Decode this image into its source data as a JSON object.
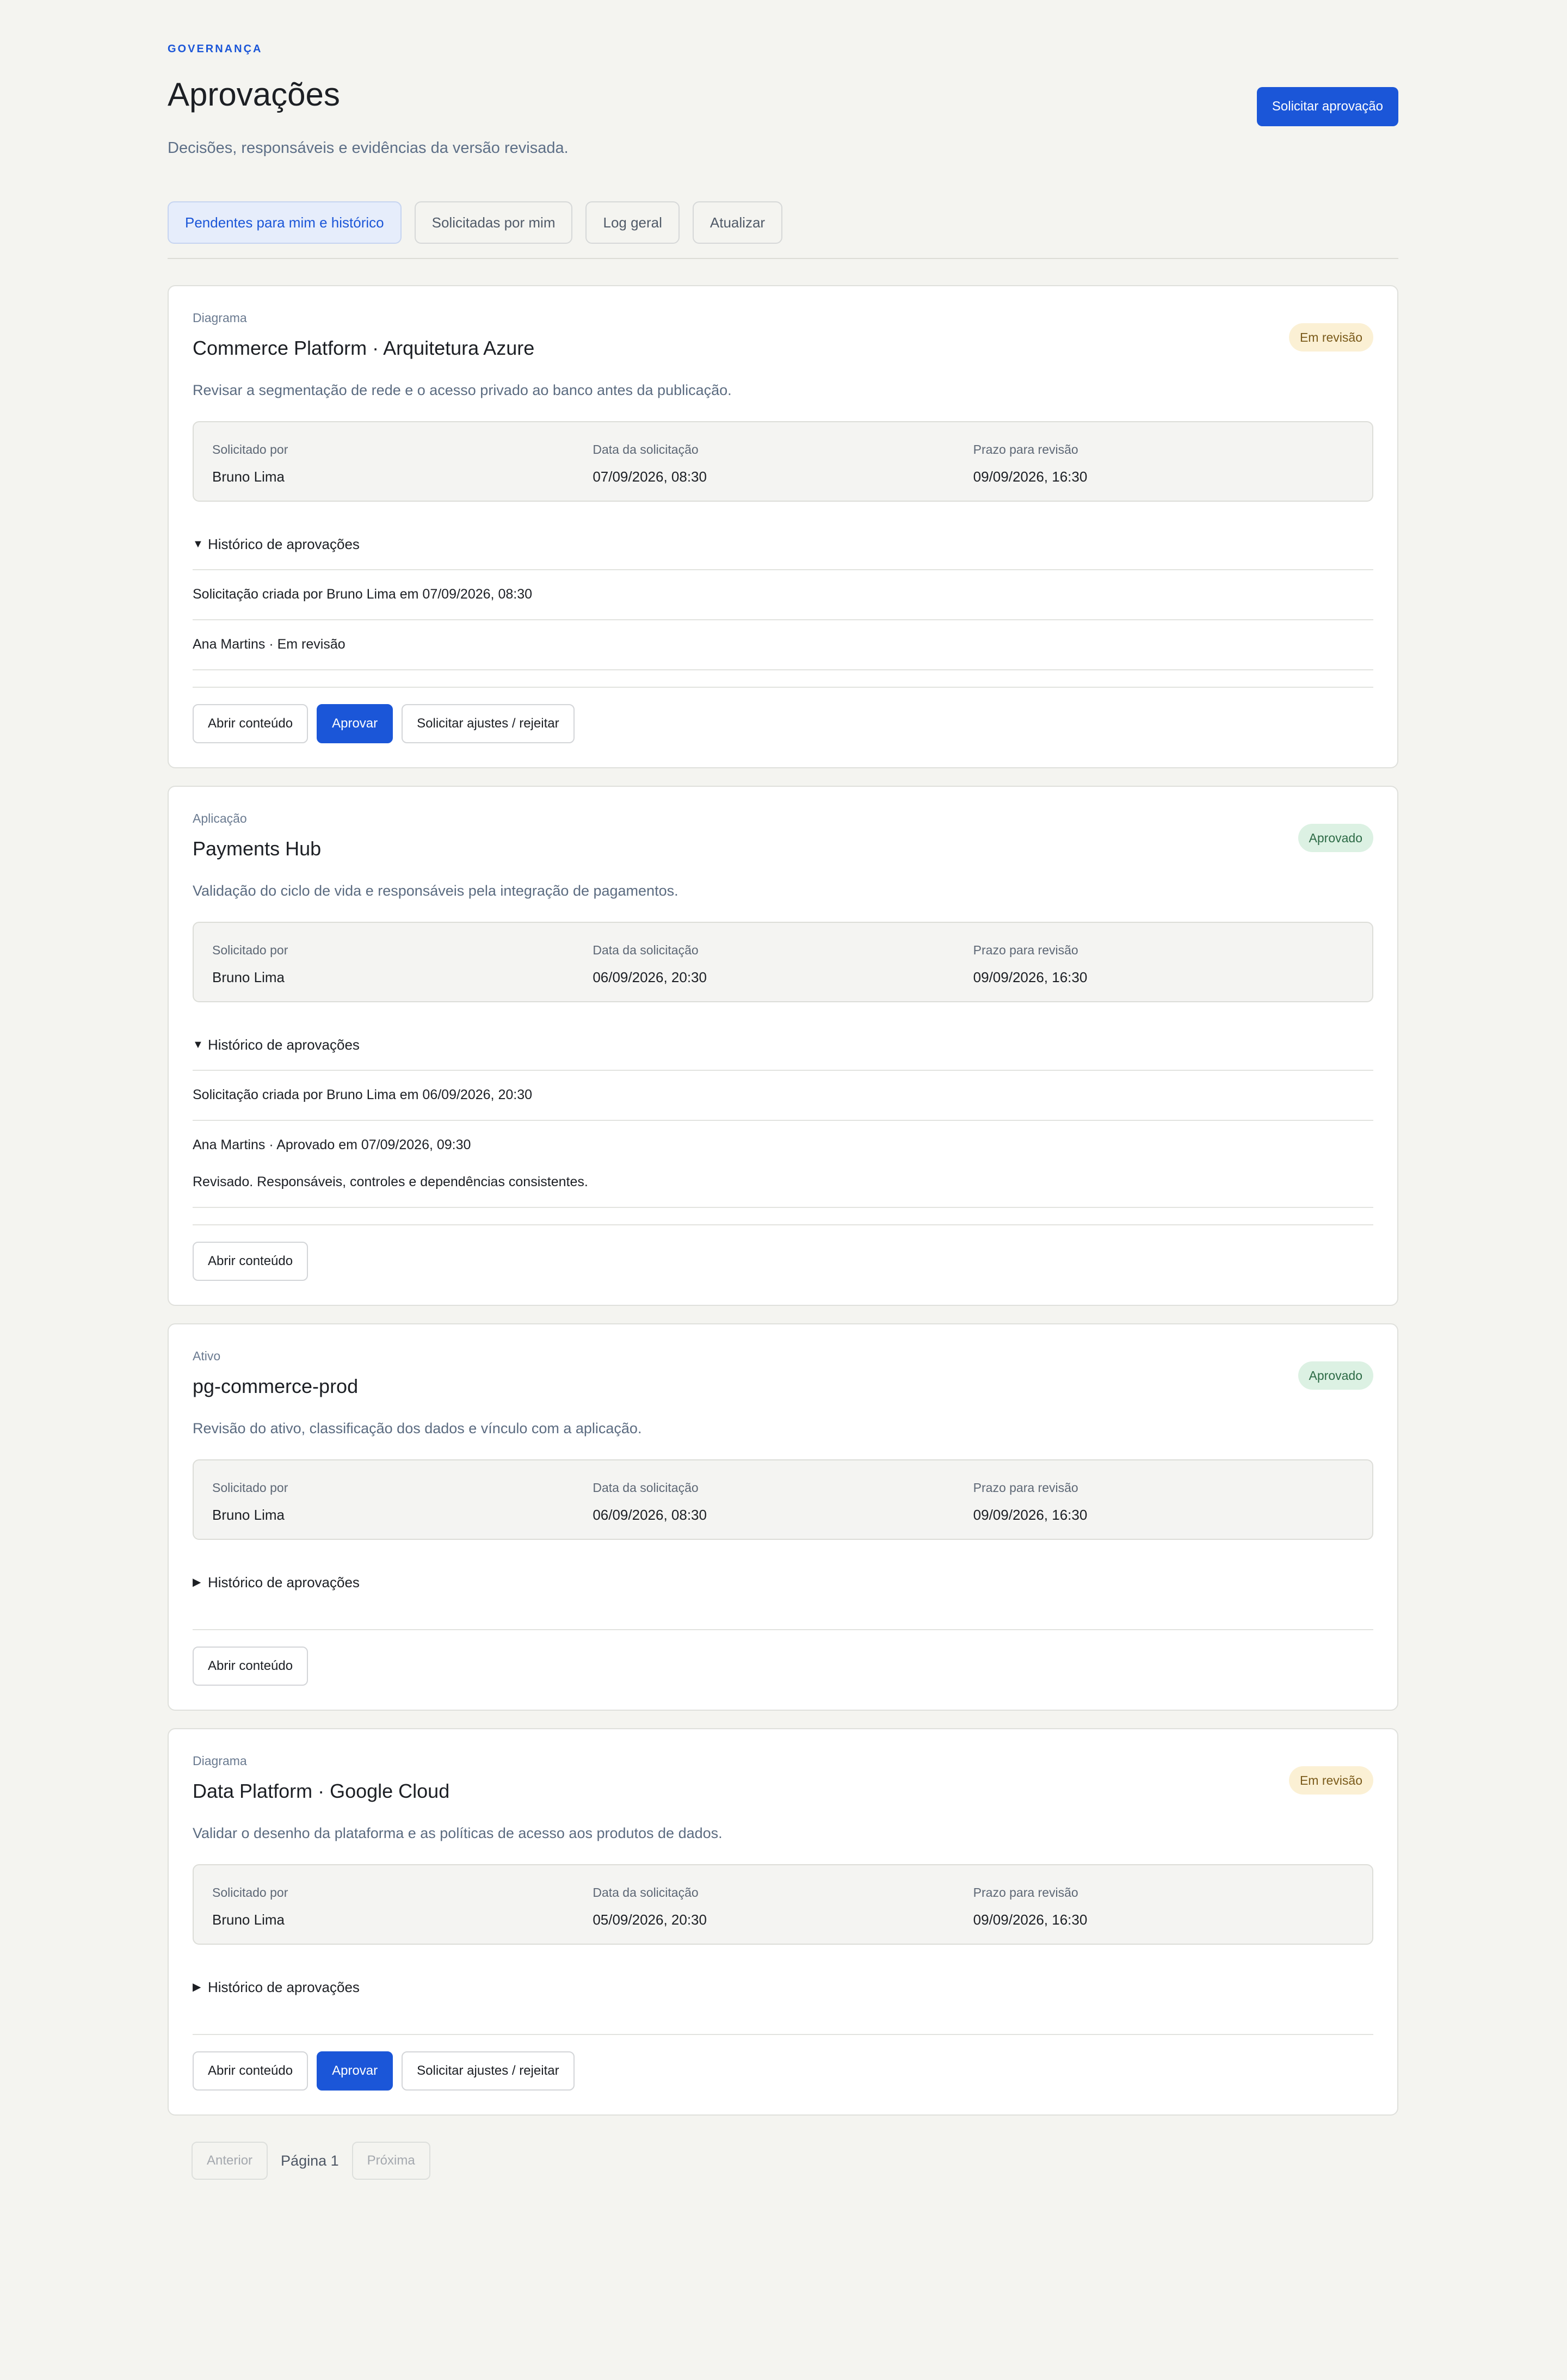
{
  "header": {
    "eyebrow": "GOVERNANÇA",
    "title": "Aprovações",
    "subtitle": "Decisões, responsáveis e evidências da versão revisada.",
    "request_button": "Solicitar aprovação"
  },
  "tabs": [
    {
      "label": "Pendentes para mim e histórico",
      "active": true
    },
    {
      "label": "Solicitadas por mim",
      "active": false
    },
    {
      "label": "Log geral",
      "active": false
    },
    {
      "label": "Atualizar",
      "active": false
    }
  ],
  "meta_labels": {
    "requested_by": "Solicitado por",
    "request_date": "Data da solicitação",
    "review_deadline": "Prazo para revisão"
  },
  "history_label": "Histórico de aprovações",
  "actions": {
    "open": "Abrir conteúdo",
    "approve": "Aprovar",
    "request_changes": "Solicitar ajustes / rejeitar"
  },
  "cards": [
    {
      "type": "Diagrama",
      "title": "Commerce Platform · Arquitetura Azure",
      "status": "Em revisão",
      "status_kind": "review",
      "description": "Revisar a segmentação de rede e o acesso privado ao banco antes da publicação.",
      "requested_by": "Bruno Lima",
      "request_date": "07/09/2026, 08:30",
      "review_deadline": "09/09/2026, 16:30",
      "history_open": true,
      "history": [
        {
          "text": "Solicitação criada por Bruno Lima em 07/09/2026, 08:30"
        },
        {
          "text": "Ana Martins · Em revisão"
        }
      ]
    },
    {
      "type": "Aplicação",
      "title": "Payments Hub",
      "status": "Aprovado",
      "status_kind": "approved",
      "description": "Validação do ciclo de vida e responsáveis pela integração de pagamentos.",
      "requested_by": "Bruno Lima",
      "request_date": "06/09/2026, 20:30",
      "review_deadline": "09/09/2026, 16:30",
      "history_open": true,
      "history": [
        {
          "text": "Solicitação criada por Bruno Lima em 06/09/2026, 20:30"
        },
        {
          "text": "Ana Martins · Aprovado em 07/09/2026, 09:30",
          "note": "Revisado. Responsáveis, controles e dependências consistentes."
        }
      ]
    },
    {
      "type": "Ativo",
      "title": "pg-commerce-prod",
      "status": "Aprovado",
      "status_kind": "approved",
      "description": "Revisão do ativo, classificação dos dados e vínculo com a aplicação.",
      "requested_by": "Bruno Lima",
      "request_date": "06/09/2026, 08:30",
      "review_deadline": "09/09/2026, 16:30",
      "history_open": false
    },
    {
      "type": "Diagrama",
      "title": "Data Platform · Google Cloud",
      "status": "Em revisão",
      "status_kind": "review",
      "description": "Validar o desenho da plataforma e as políticas de acesso aos produtos de dados.",
      "requested_by": "Bruno Lima",
      "request_date": "05/09/2026, 20:30",
      "review_deadline": "09/09/2026, 16:30",
      "history_open": false
    }
  ],
  "pagination": {
    "prev": "Anterior",
    "page": "Página 1",
    "next": "Próxima"
  }
}
